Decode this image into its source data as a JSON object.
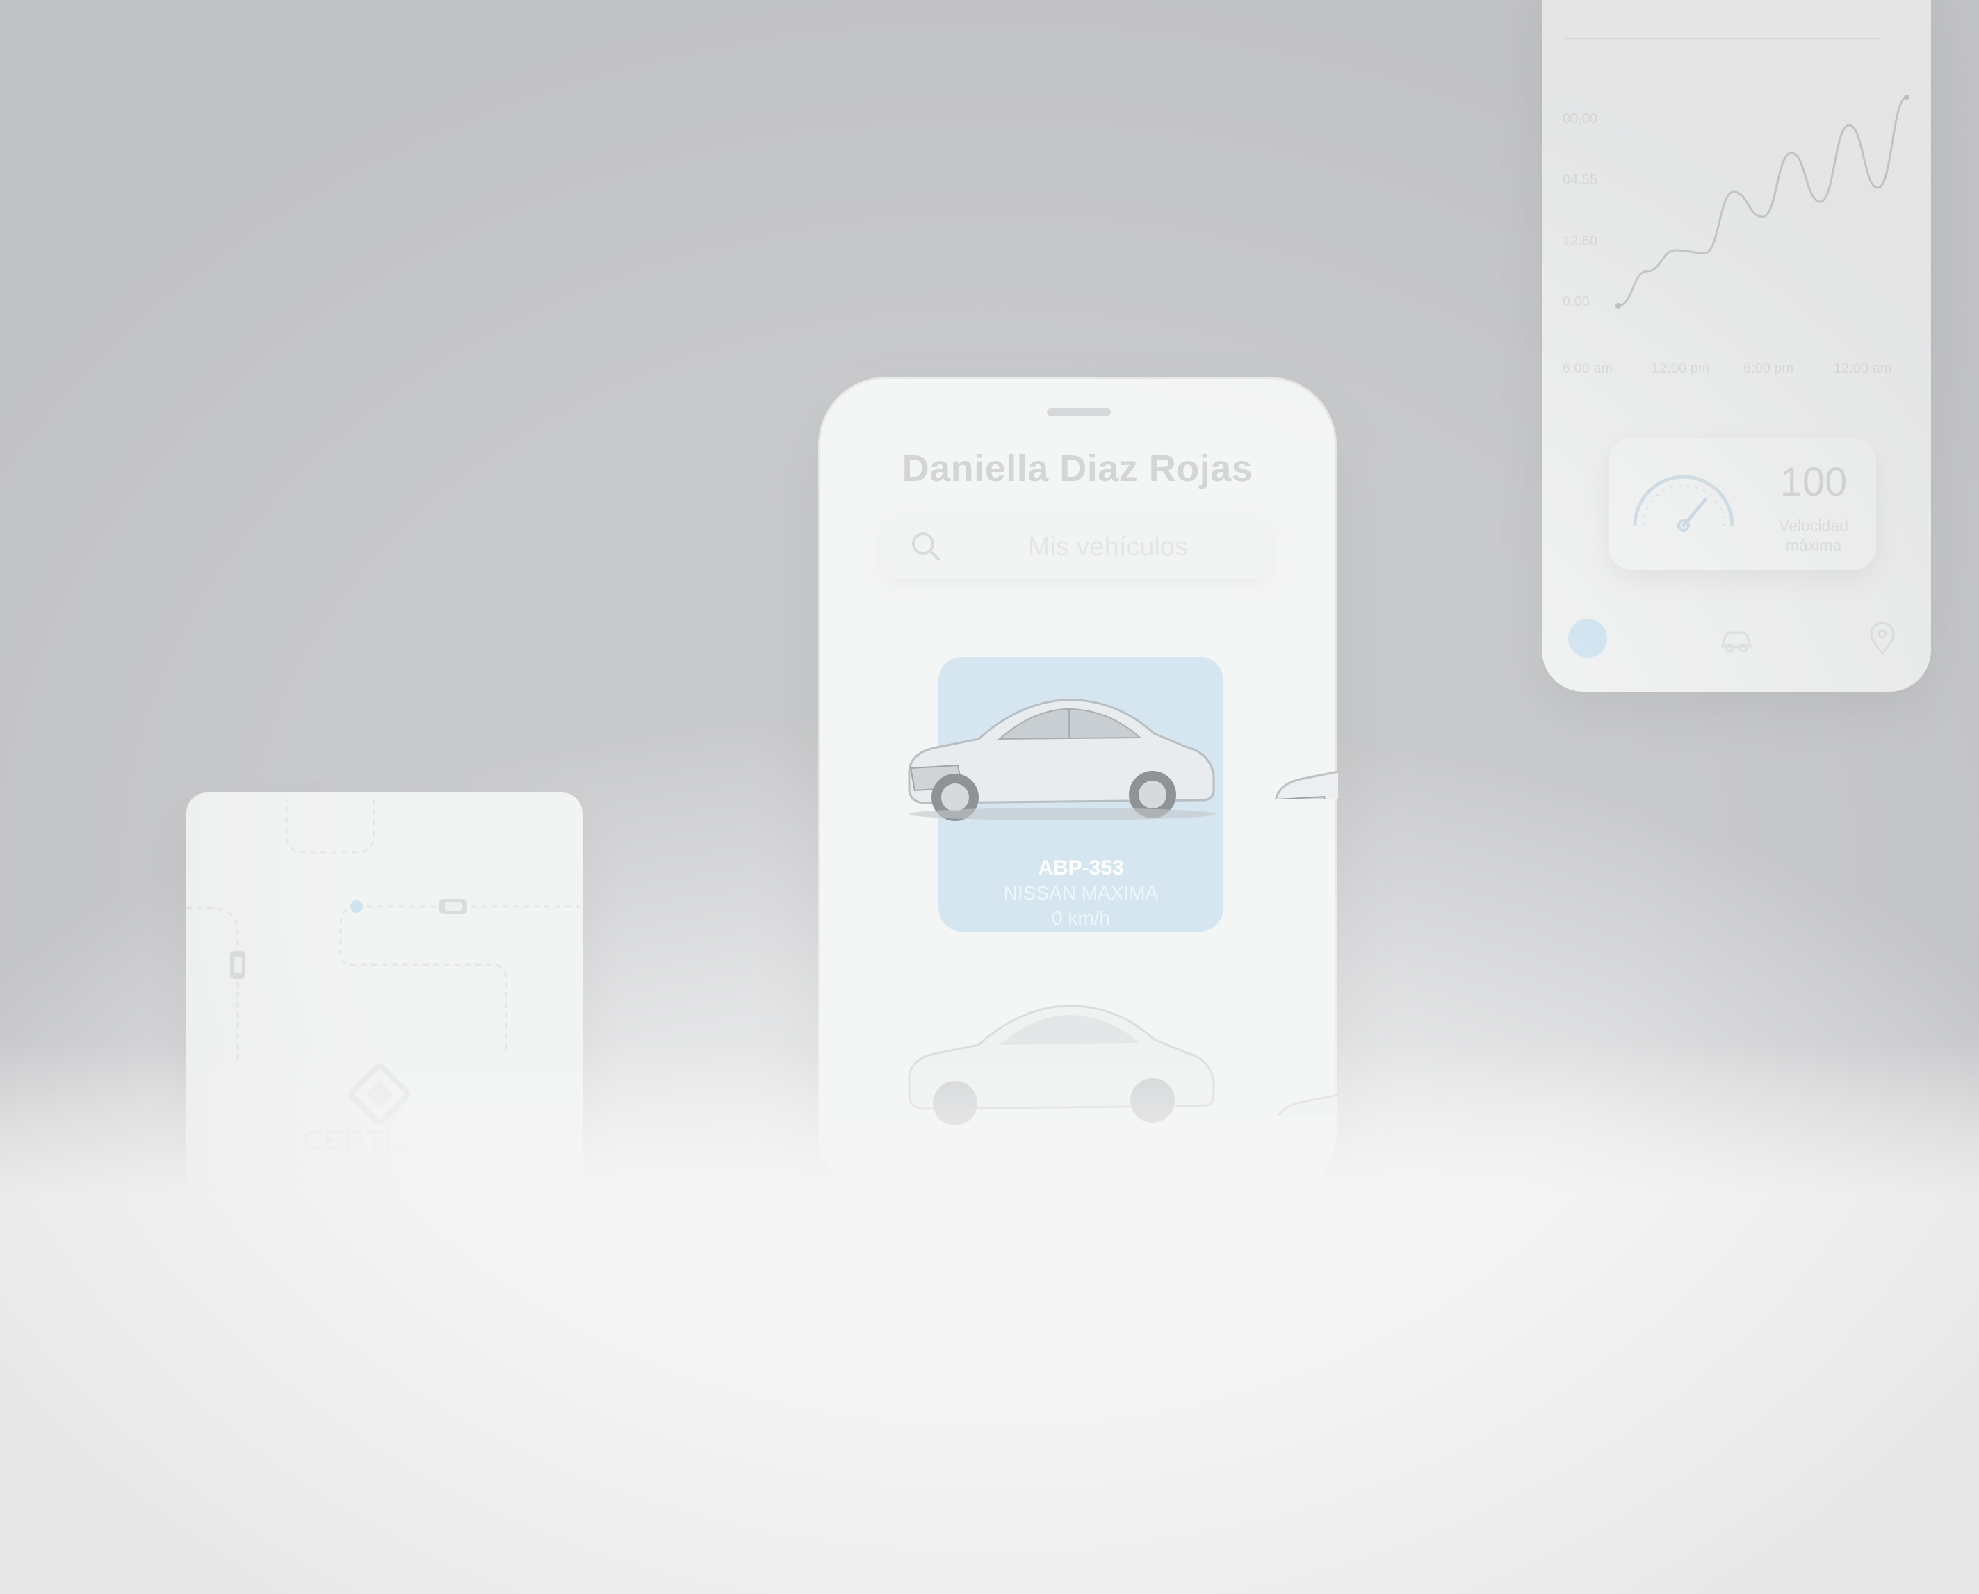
{
  "center_phone": {
    "user_name": "Daniella Diaz Rojas",
    "search": {
      "placeholder": "Mis vehículos"
    },
    "vehicles": [
      {
        "plate": "ABP-353",
        "model": "NISSAN MAXIMA",
        "speed": "0 km/h"
      }
    ]
  },
  "right_phone": {
    "chart_data": {
      "type": "line",
      "y_ticks": [
        "00.00",
        "04.55",
        "12.60",
        "0.00"
      ],
      "x_ticks": [
        "6:00 am",
        "12:00 pm",
        "6:00 pm",
        "12:00 am"
      ],
      "series": [
        {
          "values": [
            0.0,
            2.5,
            4.0,
            3.8,
            8.2,
            6.4,
            11.0,
            7.5,
            13.0,
            8.5,
            15.0
          ]
        }
      ]
    },
    "speed_card": {
      "value": "100",
      "label_line1": "Velocidad",
      "label_line2": "máxima"
    },
    "nav": {
      "icons": [
        "home-icon",
        "car-icon",
        "map-pin-icon"
      ]
    }
  },
  "left_phone": {
    "brand": {
      "text": "CERTI..."
    }
  },
  "colors": {
    "accent": "#d5e6f0",
    "card_text": "#ffffff",
    "faded_text": "#d3d5d7"
  }
}
